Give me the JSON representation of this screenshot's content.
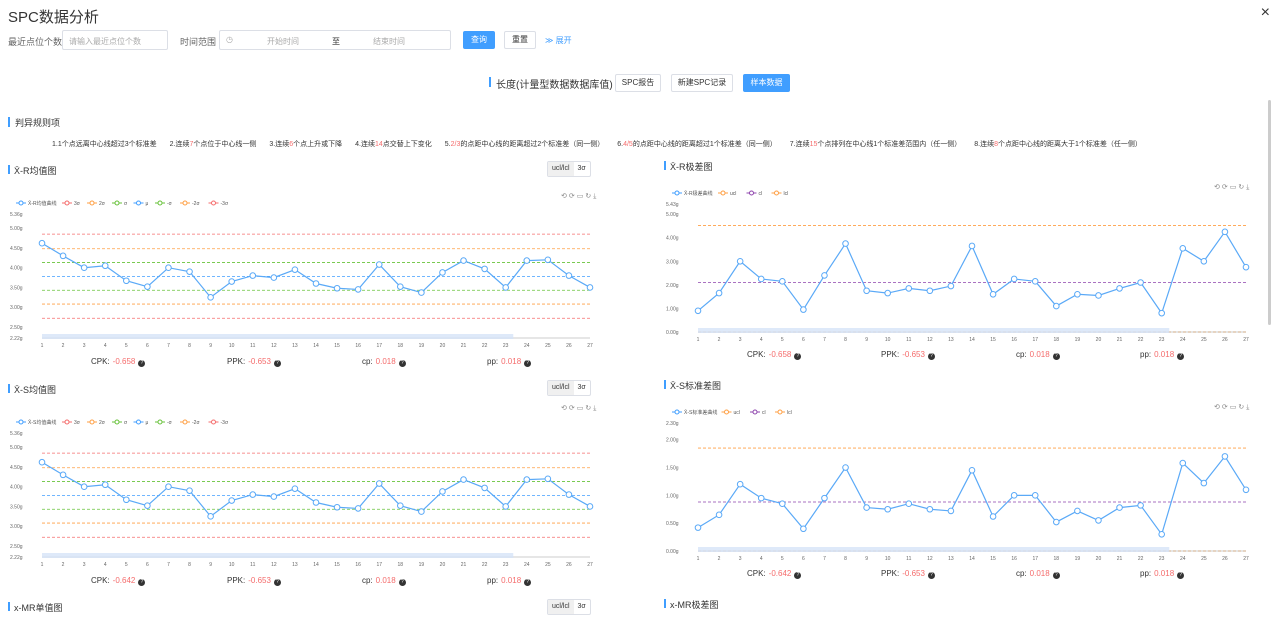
{
  "app": {
    "title": "SPC数据分析",
    "close_icon": "×"
  },
  "filter": {
    "recent_label": "最近点位个数",
    "recent_placeholder": "请输入最近点位个数",
    "time_label": "时间范围",
    "start_placeholder": "开始时间",
    "range_sep": "至",
    "end_placeholder": "结束时间",
    "query_label": "查询",
    "reset_label": "重置",
    "expand_label": "展开"
  },
  "header": {
    "title": "长度(计量型数据数据库值)",
    "report_label": "SPC报告",
    "new_label": "新建SPC记录",
    "sample_label": "样本数据"
  },
  "rules": {
    "title": "判异规则项",
    "items": [
      {
        "pre": "1.1个点远离中心线超过3个标准差",
        "num": "",
        "post": ""
      },
      {
        "pre": "2.连续",
        "num": "7",
        "post": "个点位于中心线一侧"
      },
      {
        "pre": "3.连续",
        "num": "6",
        "post": "个点上升或下降"
      },
      {
        "pre": "4.连续",
        "num": "14",
        "post": "点交替上下变化"
      },
      {
        "pre": "5.",
        "num": "2/3",
        "post": "的点距中心线的距离超过2个标准差（同一侧）"
      },
      {
        "pre": "6.",
        "num": "4/5",
        "post": "的点距中心线的距离超过1个标准差（同一侧）"
      },
      {
        "pre": "7.连续",
        "num": "15",
        "post": "个点排列在中心线1个标准差范围内（任一侧）"
      },
      {
        "pre": "8.连续",
        "num": "8",
        "post": "个点距中心线的距离大于1个标准差（任一侧）"
      }
    ]
  },
  "toggle": {
    "ucl": "ucl/lcl",
    "sigma": "3σ"
  },
  "panels": {
    "xr_mean": {
      "title": "X̄-R均值图",
      "cpk": "CPK:",
      "cpk_val": "-0.658",
      "ppk": "PPK:",
      "ppk_val": "-0.653",
      "cp": "cp:",
      "cp_val": "0.018",
      "pp": "pp:",
      "pp_val": "0.018"
    },
    "xr_range": {
      "title": "X̄-R极差图",
      "cpk": "CPK:",
      "cpk_val": "-0.658",
      "ppk": "PPK:",
      "ppk_val": "-0.653",
      "cp": "cp:",
      "cp_val": "0.018",
      "pp": "pp:",
      "pp_val": "0.018"
    },
    "xs_mean": {
      "title": "X̄-S均值图",
      "cpk": "CPK:",
      "cpk_val": "-0.642",
      "ppk": "PPK:",
      "ppk_val": "-0.653",
      "cp": "cp:",
      "cp_val": "0.018",
      "pp": "pp:",
      "pp_val": "0.018"
    },
    "xs_std": {
      "title": "X̄-S标准差图",
      "cpk": "CPK:",
      "cpk_val": "-0.642",
      "ppk": "PPK:",
      "ppk_val": "-0.653",
      "cp": "cp:",
      "cp_val": "0.018",
      "pp": "pp:",
      "pp_val": "0.018"
    },
    "x_mr_mean": {
      "title": "x-MR单值图"
    },
    "x_mr_range": {
      "title": "x-MR极差图"
    }
  },
  "chart_data": [
    {
      "id": "xr_mean",
      "type": "line",
      "legend": [
        "X̄-R均值曲线",
        "3σ",
        "2σ",
        "σ",
        "μ",
        "-σ",
        "-2σ",
        "-3σ"
      ],
      "x": [
        1,
        2,
        3,
        4,
        5,
        6,
        7,
        8,
        9,
        10,
        11,
        12,
        13,
        14,
        15,
        16,
        17,
        18,
        19,
        20,
        21,
        22,
        23,
        24,
        25,
        26,
        27
      ],
      "values": [
        4.62,
        4.3,
        4.0,
        4.05,
        3.67,
        3.52,
        4.0,
        3.9,
        3.25,
        3.65,
        3.8,
        3.75,
        3.95,
        3.6,
        3.48,
        3.45,
        4.08,
        3.52,
        3.37,
        3.88,
        4.18,
        3.97,
        3.5,
        4.18,
        4.2,
        3.8,
        3.5
      ],
      "yticks": [
        "2.22g",
        "2.50g",
        "3.00g",
        "3.50g",
        "4.00g",
        "4.50g",
        "5.00g",
        "5.36g"
      ],
      "ylim": [
        2.22,
        5.36
      ],
      "lines": [
        {
          "name": "3σ",
          "y": 4.85,
          "color": "#f56c6c"
        },
        {
          "name": "2σ",
          "y": 4.48,
          "color": "#ff9f43"
        },
        {
          "name": "σ",
          "y": 4.13,
          "color": "#67c23a"
        },
        {
          "name": "μ",
          "y": 3.78,
          "color": "#409eff"
        },
        {
          "name": "-σ",
          "y": 3.43,
          "color": "#67c23a"
        },
        {
          "name": "-2σ",
          "y": 3.08,
          "color": "#ff9f43"
        },
        {
          "name": "-3σ",
          "y": 2.72,
          "color": "#f56c6c"
        }
      ]
    },
    {
      "id": "xr_range",
      "type": "line",
      "legend": [
        "X̄-R极差曲线",
        "ucl",
        "cl",
        "lcl"
      ],
      "x": [
        1,
        2,
        3,
        4,
        5,
        6,
        7,
        8,
        9,
        10,
        11,
        12,
        13,
        14,
        15,
        16,
        17,
        18,
        19,
        20,
        21,
        22,
        23,
        24,
        25,
        26,
        27
      ],
      "values": [
        0.9,
        1.65,
        3.0,
        2.25,
        2.15,
        0.95,
        2.4,
        3.75,
        1.75,
        1.65,
        1.85,
        1.75,
        1.95,
        3.65,
        1.6,
        2.25,
        2.15,
        1.1,
        1.6,
        1.55,
        1.85,
        2.1,
        0.8,
        3.55,
        3.0,
        4.25,
        2.75
      ],
      "yticks": [
        "0.00g",
        "1.00g",
        "2.00g",
        "3.00g",
        "4.00g",
        "5.00g",
        "5.43g"
      ],
      "ylim": [
        0,
        5.43
      ],
      "lines": [
        {
          "name": "ucl",
          "y": 4.52,
          "color": "#ff9f43"
        },
        {
          "name": "cl",
          "y": 2.1,
          "color": "#8e44ad"
        },
        {
          "name": "lcl",
          "y": 0.0,
          "color": "#ff9f43"
        }
      ]
    },
    {
      "id": "xs_mean",
      "type": "line",
      "legend": [
        "X̄-S均值曲线",
        "3σ",
        "2σ",
        "σ",
        "μ",
        "-σ",
        "-2σ",
        "-3σ"
      ],
      "x": [
        1,
        2,
        3,
        4,
        5,
        6,
        7,
        8,
        9,
        10,
        11,
        12,
        13,
        14,
        15,
        16,
        17,
        18,
        19,
        20,
        21,
        22,
        23,
        24,
        25,
        26,
        27
      ],
      "values": [
        4.62,
        4.3,
        4.0,
        4.05,
        3.67,
        3.52,
        4.0,
        3.9,
        3.25,
        3.65,
        3.8,
        3.75,
        3.95,
        3.6,
        3.48,
        3.45,
        4.08,
        3.52,
        3.37,
        3.88,
        4.18,
        3.97,
        3.5,
        4.18,
        4.2,
        3.8,
        3.5
      ],
      "yticks": [
        "2.22g",
        "2.50g",
        "3.00g",
        "3.50g",
        "4.00g",
        "4.50g",
        "5.00g",
        "5.36g"
      ],
      "ylim": [
        2.22,
        5.36
      ],
      "lines": [
        {
          "name": "3σ",
          "y": 4.85,
          "color": "#f56c6c"
        },
        {
          "name": "2σ",
          "y": 4.48,
          "color": "#ff9f43"
        },
        {
          "name": "σ",
          "y": 4.13,
          "color": "#67c23a"
        },
        {
          "name": "μ",
          "y": 3.78,
          "color": "#409eff"
        },
        {
          "name": "-σ",
          "y": 3.43,
          "color": "#67c23a"
        },
        {
          "name": "-2σ",
          "y": 3.08,
          "color": "#ff9f43"
        },
        {
          "name": "-3σ",
          "y": 2.72,
          "color": "#f56c6c"
        }
      ]
    },
    {
      "id": "xs_std",
      "type": "line",
      "legend": [
        "X̄-S标准差曲线",
        "ucl",
        "cl",
        "lcl"
      ],
      "x": [
        1,
        2,
        3,
        4,
        5,
        6,
        7,
        8,
        9,
        10,
        11,
        12,
        13,
        14,
        15,
        16,
        17,
        18,
        19,
        20,
        21,
        22,
        23,
        24,
        25,
        26,
        27
      ],
      "values": [
        0.42,
        0.65,
        1.2,
        0.95,
        0.85,
        0.4,
        0.95,
        1.5,
        0.78,
        0.75,
        0.85,
        0.75,
        0.72,
        1.45,
        0.62,
        1.0,
        1.0,
        0.52,
        0.72,
        0.55,
        0.78,
        0.82,
        0.3,
        1.58,
        1.22,
        1.7,
        1.1
      ],
      "yticks": [
        "0.00g",
        "0.50g",
        "1.00g",
        "1.50g",
        "2.00g",
        "2.30g"
      ],
      "ylim": [
        0,
        2.3
      ],
      "lines": [
        {
          "name": "ucl",
          "y": 1.85,
          "color": "#ff9f43"
        },
        {
          "name": "cl",
          "y": 0.88,
          "color": "#8e44ad"
        },
        {
          "name": "lcl",
          "y": 0.0,
          "color": "#ff9f43"
        }
      ]
    }
  ]
}
